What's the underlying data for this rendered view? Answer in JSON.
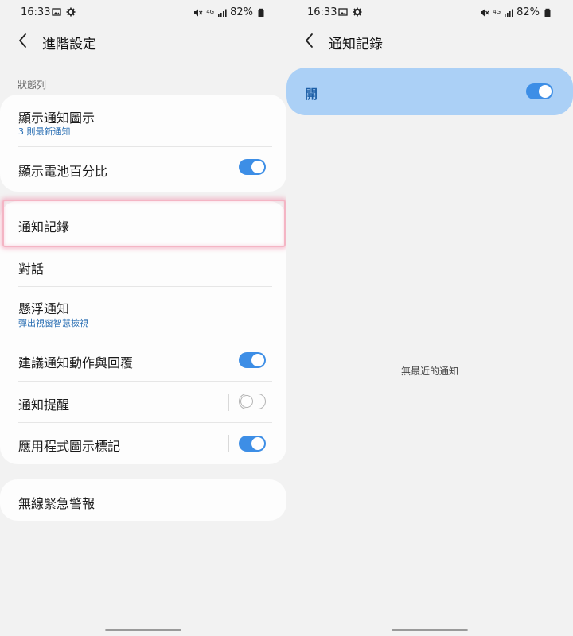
{
  "status_bar": {
    "time": "16:33",
    "network": "4G",
    "battery_percent": "82%"
  },
  "left_screen": {
    "title": "進階設定",
    "section_label": "狀態列",
    "card1": [
      {
        "label": "顯示通知圖示",
        "sublabel": "3 則最新通知"
      },
      {
        "label": "顯示電池百分比",
        "toggle": true
      }
    ],
    "card2": [
      {
        "label": "通知記錄"
      },
      {
        "label": "對話"
      },
      {
        "label": "懸浮通知",
        "sublabel": "彈出視窗智慧檢視"
      },
      {
        "label": "建議通知動作與回覆",
        "toggle": true
      },
      {
        "label": "通知提醒",
        "toggle": false
      },
      {
        "label": "應用程式圖示標記",
        "toggle": true
      }
    ],
    "card3": [
      {
        "label": "無線緊急警報"
      }
    ]
  },
  "right_screen": {
    "title": "通知記錄",
    "master_label": "開",
    "master_toggle": true,
    "empty_text": "無最近的通知"
  },
  "colors": {
    "accent": "#3d8ee6",
    "sublabel": "#2a6fb3",
    "master_bg": "#abd0f6",
    "highlight": "#f4b5c4"
  },
  "icons": [
    "back-arrow-icon",
    "gallery-icon",
    "gear-icon",
    "mute-icon",
    "signal-icon",
    "battery-icon"
  ]
}
